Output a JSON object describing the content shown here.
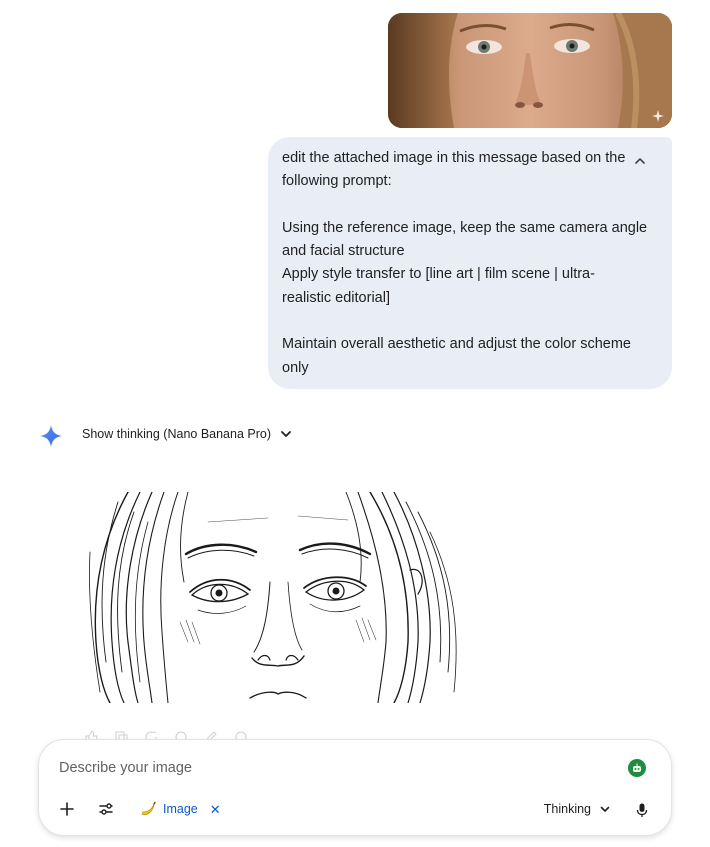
{
  "user_message": {
    "photo_alt_icon": "sparkle-icon",
    "prompt_lines": [
      "edit the attached image in this message based on the",
      "following prompt:",
      "",
      "Using the reference image, keep the same camera angle",
      "and facial structure",
      "Apply style transfer to [line art | film scene | ultra-",
      "realistic editorial]",
      "",
      "Maintain overall aesthetic and adjust the color scheme",
      "only"
    ],
    "collapse_icon": "chevron-up-icon"
  },
  "response": {
    "model_icon": "gemini-spark-icon",
    "thinking_label": "Show thinking (Nano Banana Pro)",
    "thinking_icon": "chevron-down-icon"
  },
  "composer": {
    "placeholder": "Describe your image",
    "value": "",
    "add_icon": "plus-icon",
    "tools_icon": "tune-icon",
    "chip_icon": "banana-icon",
    "chip_label": "Image",
    "chip_close": "✕",
    "mode_label": "Thinking",
    "mode_icon": "chevron-down-icon",
    "mic_icon": "mic-icon",
    "agent_icon": "robot-icon"
  },
  "colors": {
    "bubble": "#e9eef6",
    "accent_blue": "#0b57d0",
    "gemini_blue": "#4285f4",
    "agent_green": "#1e8e3e"
  }
}
